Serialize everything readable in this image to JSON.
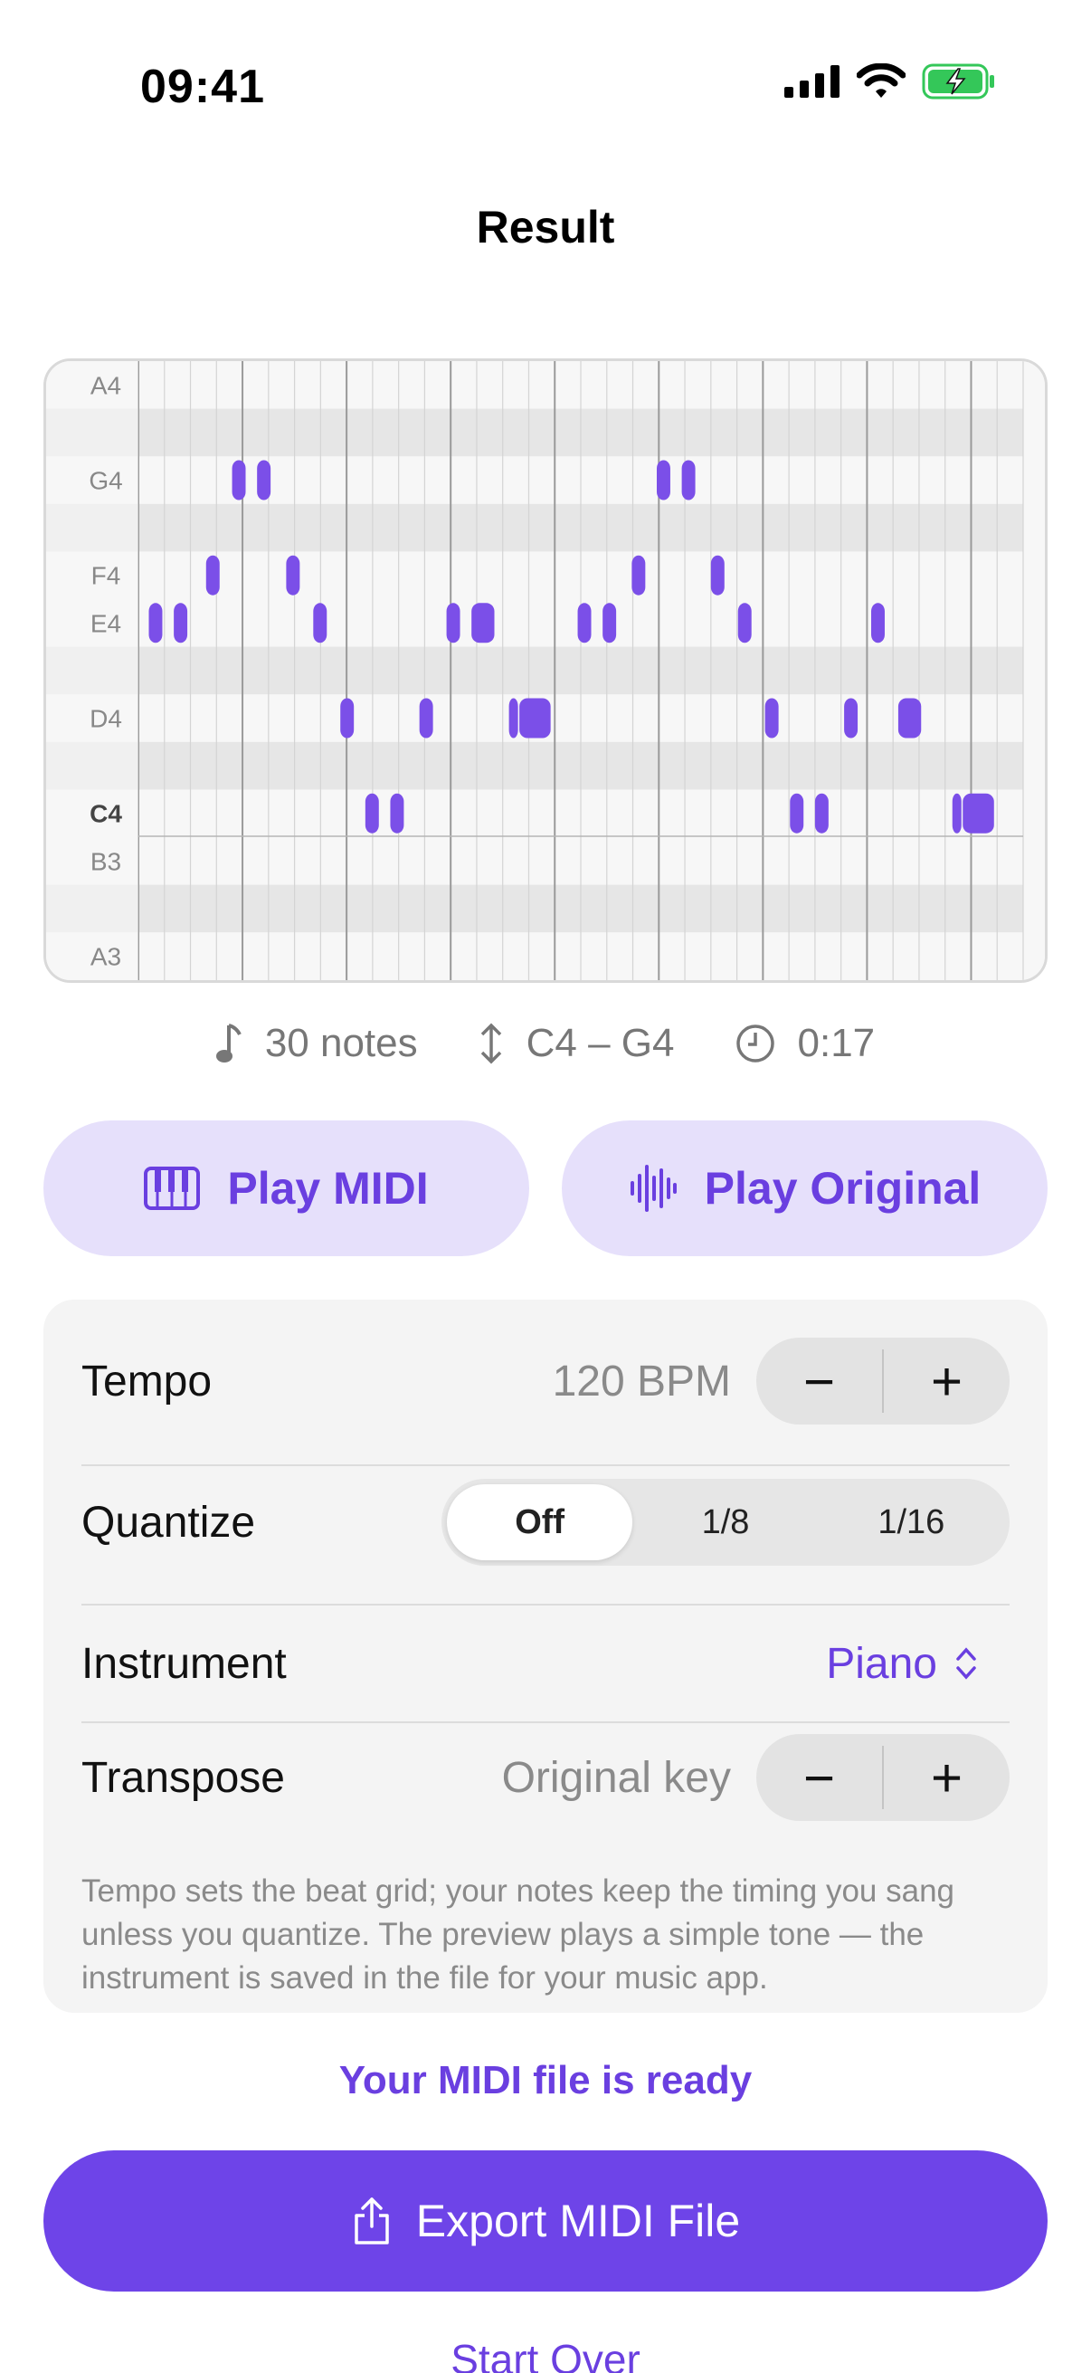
{
  "status_bar": {
    "time": "09:41"
  },
  "header": {
    "title": "Result"
  },
  "piano_roll": {
    "row_labels": [
      {
        "label": "A4",
        "row": 0,
        "bold": false
      },
      {
        "label": "G4",
        "row": 2,
        "bold": false
      },
      {
        "label": "F4",
        "row": 4,
        "bold": false
      },
      {
        "label": "E4",
        "row": 5,
        "bold": false
      },
      {
        "label": "D4",
        "row": 7,
        "bold": false
      },
      {
        "label": "C4",
        "row": 9,
        "bold": true
      },
      {
        "label": "B3",
        "row": 10,
        "bold": false
      },
      {
        "label": "A3",
        "row": 12,
        "bold": false
      }
    ],
    "note_color": "#7b4fe8",
    "notes": [
      {
        "row": 5,
        "t": 0.1,
        "d": 0.13
      },
      {
        "row": 5,
        "t": 0.34,
        "d": 0.13
      },
      {
        "row": 4,
        "t": 0.65,
        "d": 0.13
      },
      {
        "row": 2,
        "t": 0.9,
        "d": 0.13
      },
      {
        "row": 2,
        "t": 1.14,
        "d": 0.13
      },
      {
        "row": 4,
        "t": 1.42,
        "d": 0.13
      },
      {
        "row": 5,
        "t": 1.68,
        "d": 0.13
      },
      {
        "row": 7,
        "t": 1.94,
        "d": 0.13
      },
      {
        "row": 9,
        "t": 2.18,
        "d": 0.13
      },
      {
        "row": 9,
        "t": 2.42,
        "d": 0.13
      },
      {
        "row": 7,
        "t": 2.7,
        "d": 0.13
      },
      {
        "row": 5,
        "t": 2.96,
        "d": 0.13
      },
      {
        "row": 5,
        "t": 3.2,
        "d": 0.22
      },
      {
        "row": 7,
        "t": 3.56,
        "d": 0.05
      },
      {
        "row": 7,
        "t": 3.66,
        "d": 0.3
      },
      {
        "row": 5,
        "t": 4.22,
        "d": 0.13
      },
      {
        "row": 5,
        "t": 4.46,
        "d": 0.13
      },
      {
        "row": 4,
        "t": 4.74,
        "d": 0.13
      },
      {
        "row": 2,
        "t": 4.98,
        "d": 0.13
      },
      {
        "row": 2,
        "t": 5.22,
        "d": 0.13
      },
      {
        "row": 4,
        "t": 5.5,
        "d": 0.13
      },
      {
        "row": 5,
        "t": 5.76,
        "d": 0.13
      },
      {
        "row": 7,
        "t": 6.02,
        "d": 0.13
      },
      {
        "row": 9,
        "t": 6.26,
        "d": 0.13
      },
      {
        "row": 9,
        "t": 6.5,
        "d": 0.13
      },
      {
        "row": 7,
        "t": 6.78,
        "d": 0.13
      },
      {
        "row": 5,
        "t": 7.04,
        "d": 0.13
      },
      {
        "row": 7,
        "t": 7.3,
        "d": 0.22
      },
      {
        "row": 9,
        "t": 7.82,
        "d": 0.05
      },
      {
        "row": 9,
        "t": 7.92,
        "d": 0.3
      }
    ]
  },
  "stats": {
    "notes": "30 notes",
    "range": "C4 – G4",
    "duration": "0:17"
  },
  "buttons": {
    "play_midi": "Play MIDI",
    "play_original": "Play Original"
  },
  "settings": {
    "tempo": {
      "label": "Tempo",
      "value": "120 BPM",
      "minus": "−",
      "plus": "+"
    },
    "quantize": {
      "label": "Quantize",
      "options": [
        "Off",
        "1/8",
        "1/16"
      ],
      "selected": 0
    },
    "instrument": {
      "label": "Instrument",
      "value": "Piano"
    },
    "transpose": {
      "label": "Transpose",
      "value": "Original key",
      "minus": "−",
      "plus": "+"
    },
    "footnote": "Tempo sets the beat grid; your notes keep the timing you sang unless you quantize. The preview plays a simple tone — the instrument is saved in the file for your music app."
  },
  "ready_text": "Your MIDI file is ready",
  "export_label": "Export MIDI File",
  "start_over_label": "Start Over",
  "colors": {
    "accent": "#6e44e8",
    "accent_light": "#e6e0fb"
  }
}
